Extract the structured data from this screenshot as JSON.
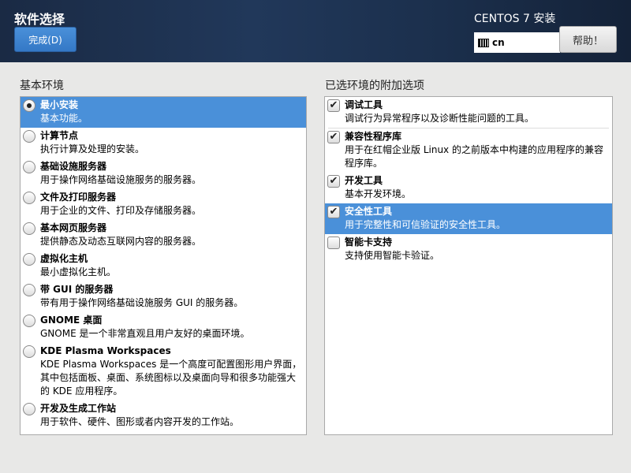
{
  "header": {
    "title": "软件选择",
    "done_label": "完成(D)",
    "product": "CENTOS 7 安装",
    "keyboard_layout": "cn",
    "help_label": "帮助！"
  },
  "base_env": {
    "heading": "基本环境",
    "items": [
      {
        "name": "最小安装",
        "desc": "基本功能。",
        "selected": true
      },
      {
        "name": "计算节点",
        "desc": "执行计算及处理的安装。",
        "selected": false
      },
      {
        "name": "基础设施服务器",
        "desc": "用于操作网络基础设施服务的服务器。",
        "selected": false
      },
      {
        "name": "文件及打印服务器",
        "desc": "用于企业的文件、打印及存储服务器。",
        "selected": false
      },
      {
        "name": "基本网页服务器",
        "desc": "提供静态及动态互联网内容的服务器。",
        "selected": false
      },
      {
        "name": "虚拟化主机",
        "desc": "最小虚拟化主机。",
        "selected": false
      },
      {
        "name": "带 GUI 的服务器",
        "desc": "带有用于操作网络基础设施服务 GUI 的服务器。",
        "selected": false
      },
      {
        "name": "GNOME 桌面",
        "desc": "GNOME 是一个非常直观且用户友好的桌面环境。",
        "selected": false
      },
      {
        "name": "KDE Plasma Workspaces",
        "desc": "KDE Plasma Workspaces 是一个高度可配置图形用户界面，其中包括面板、桌面、系统图标以及桌面向导和很多功能强大的 KDE 应用程序。",
        "selected": false
      },
      {
        "name": "开发及生成工作站",
        "desc": "用于软件、硬件、图形或者内容开发的工作站。",
        "selected": false
      }
    ]
  },
  "addons": {
    "heading": "已选环境的附加选项",
    "items": [
      {
        "name": "调试工具",
        "desc": "调试行为异常程序以及诊断性能问题的工具。",
        "checked": true
      },
      {
        "name": "兼容性程序库",
        "desc": "用于在红帽企业版 Linux 的之前版本中构建的应用程序的兼容程序库。",
        "checked": true
      },
      {
        "name": "开发工具",
        "desc": "基本开发环境。",
        "checked": true
      },
      {
        "name": "安全性工具",
        "desc": "用于完整性和可信验证的安全性工具。",
        "checked": true
      },
      {
        "name": "智能卡支持",
        "desc": "支持使用智能卡验证。",
        "checked": false
      }
    ]
  },
  "colors": {
    "accent": "#4a90d9",
    "header_bg": "#1b2f4c"
  }
}
